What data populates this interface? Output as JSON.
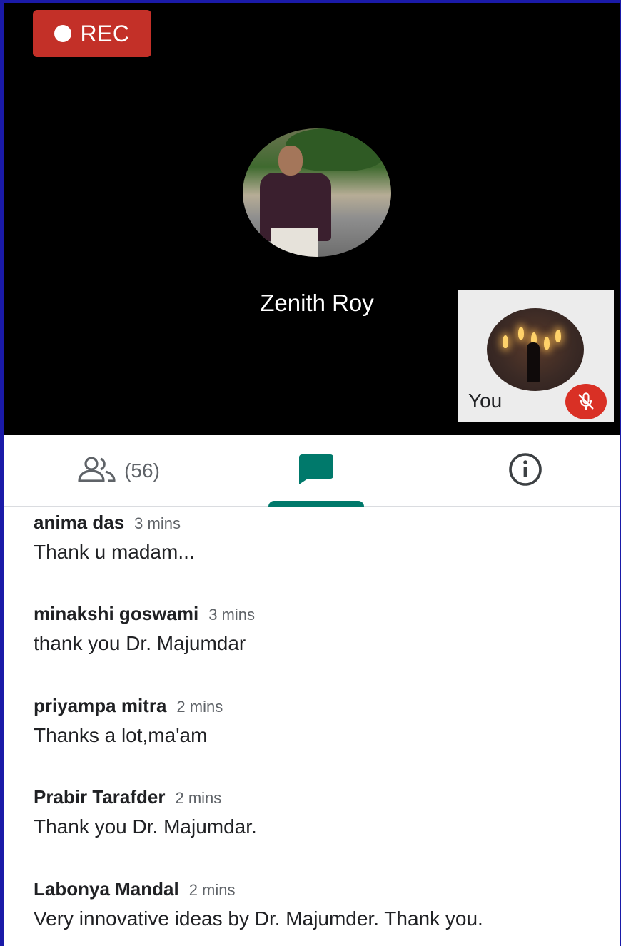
{
  "recording": {
    "label": "REC"
  },
  "speaker": {
    "name": "Zenith Roy"
  },
  "self_tile": {
    "name": "You",
    "mic_status": "muted"
  },
  "tabs": {
    "people": {
      "count_label": "(56)"
    },
    "chat": {
      "active": true
    },
    "info": {}
  },
  "messages": [
    {
      "sender": "anima das",
      "time": "3 mins",
      "text": "Thank u madam..."
    },
    {
      "sender": "minakshi goswami",
      "time": "3 mins",
      "text": "thank you Dr. Majumdar"
    },
    {
      "sender": "priyampa mitra",
      "time": "2 mins",
      "text": "Thanks a lot,ma'am"
    },
    {
      "sender": "Prabir Tarafder",
      "time": "2 mins",
      "text": "Thank you Dr. Majumdar."
    },
    {
      "sender": "Labonya Mandal",
      "time": "2 mins",
      "text": "Very innovative ideas by Dr. Majumder. Thank you."
    }
  ],
  "colors": {
    "rec_badge": "#c33028",
    "accent_teal": "#00796b",
    "mic_off": "#d93025",
    "stage_background": "#000000"
  },
  "icons": {
    "people_tab": "people-icon",
    "chat_tab": "chat-bubble-icon",
    "info_tab": "info-icon",
    "mic": "mic-off-icon"
  }
}
